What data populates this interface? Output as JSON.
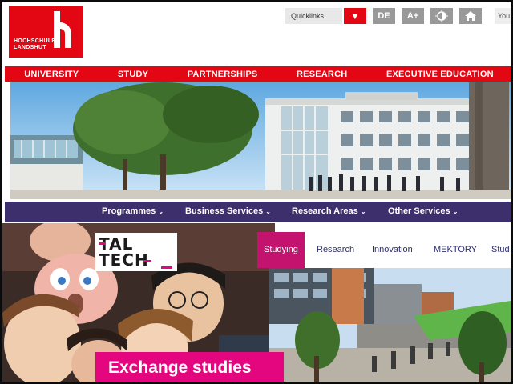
{
  "top_site": {
    "logo": {
      "line1": "HOCHSCHULE",
      "line2": "LANDSHUT",
      "color": "#e30613"
    },
    "utility": {
      "quicklinks_label": "Quicklinks",
      "language_label": "DE",
      "font_size_label": "A+",
      "contrast_icon": "contrast-icon",
      "home_icon": "home-icon",
      "search_placeholder": "You"
    },
    "main_nav": [
      "UNIVERSITY",
      "STUDY",
      "PARTNERSHIPS",
      "RESEARCH",
      "EXECUTIVE EDUCATION"
    ],
    "sub_nav": [
      "Programmes",
      "Business Services",
      "Research Areas",
      "Other Services"
    ],
    "colors": {
      "red": "#e30613",
      "purple": "#3d2f6b"
    }
  },
  "bottom_site": {
    "logo": {
      "line1": "TAL",
      "line2": "TECH",
      "accent": "#e4067e"
    },
    "nav": [
      "Studying",
      "Research",
      "Innovation",
      "MEKTORY",
      "Stud"
    ],
    "active_tab": "Studying",
    "banner_text": "Exchange studies",
    "colors": {
      "magenta": "#e4067e",
      "active_tab": "#c4126f",
      "nav_text": "#2d2d6e"
    }
  }
}
